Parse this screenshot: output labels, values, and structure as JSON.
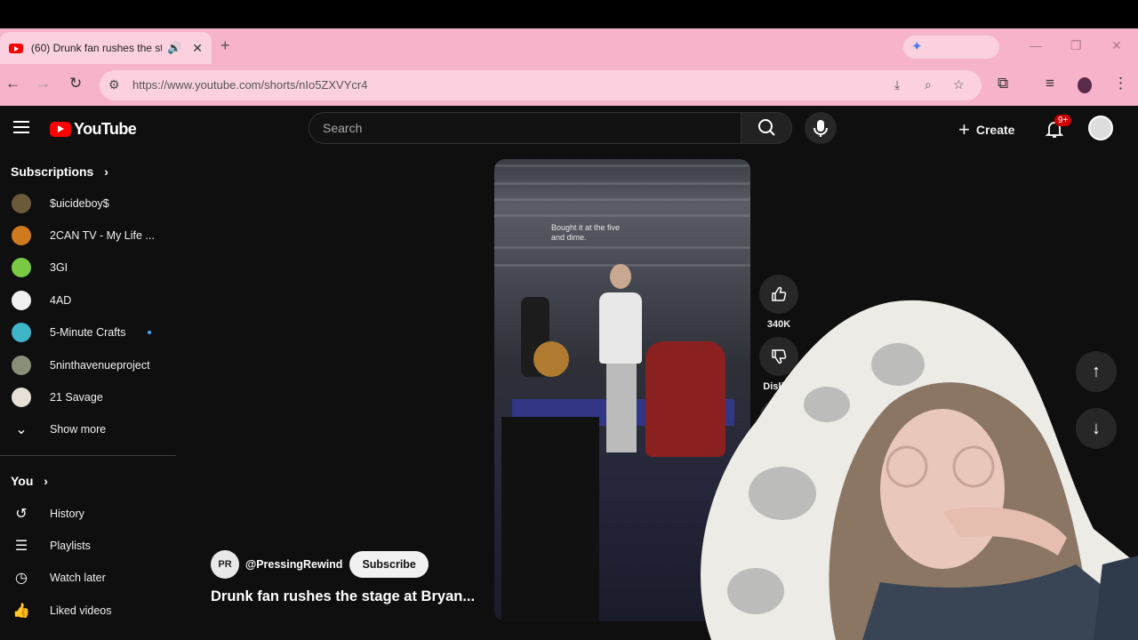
{
  "browser": {
    "tab_title": "(60) Drunk fan rushes the st",
    "url": "https://www.youtube.com/shorts/nIo5ZXVYcr4"
  },
  "header": {
    "logo_text": "YouTube",
    "search_placeholder": "Search",
    "create_label": "Create",
    "notification_count": "9+"
  },
  "sidebar": {
    "subscriptions_label": "Subscriptions",
    "subscriptions": [
      {
        "label": "$uicideboy$"
      },
      {
        "label": "2CAN TV - My Life ..."
      },
      {
        "label": "3GI"
      },
      {
        "label": "4AD"
      },
      {
        "label": "5-Minute Crafts"
      },
      {
        "label": "5ninthavenueproject"
      },
      {
        "label": "21 Savage"
      }
    ],
    "show_more_label": "Show more",
    "you_label": "You",
    "you_items": [
      {
        "label": "History"
      },
      {
        "label": "Playlists"
      },
      {
        "label": "Watch later"
      },
      {
        "label": "Liked videos"
      }
    ]
  },
  "short": {
    "caption": "Bought it at the five and dime.",
    "like_count": "340K",
    "dislike_label": "Dislike",
    "channel_handle": "@PressingRewind",
    "subscribe_label": "Subscribe",
    "title": "Drunk fan rushes the stage at Bryan..."
  }
}
